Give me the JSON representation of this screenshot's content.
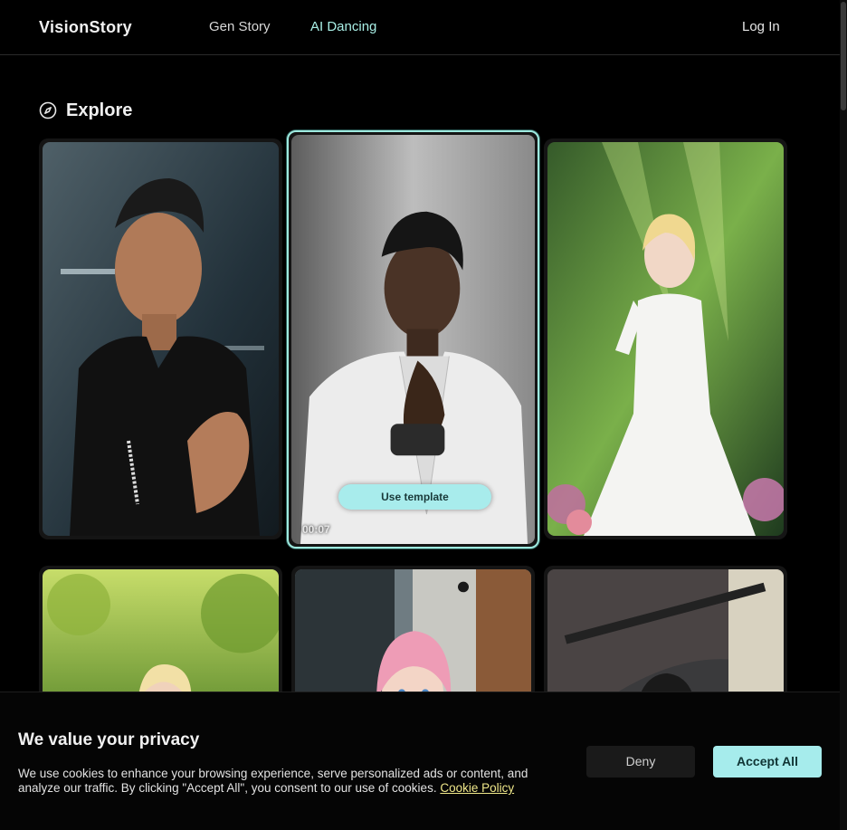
{
  "header": {
    "logo": "VisionStory",
    "nav": [
      {
        "label": "Gen Story"
      },
      {
        "label": "AI Dancing"
      }
    ],
    "login_label": "Log In"
  },
  "explore": {
    "title": "Explore",
    "icon": "compass-icon",
    "active_card": {
      "use_template_label": "Use template",
      "duration": "00:07"
    }
  },
  "cookie_banner": {
    "title": "We value your privacy",
    "text": "We use cookies to enhance your browsing experience, serve personalized ads or content, and analyze our traffic. By clicking \"Accept All\", you consent to our use of cookies.",
    "link": "Cookie Policy",
    "deny_label": "Deny",
    "accept_label": "Accept All"
  },
  "colors": {
    "accent": "#a8ecec",
    "background": "#000000",
    "link": "#f0e88a"
  }
}
